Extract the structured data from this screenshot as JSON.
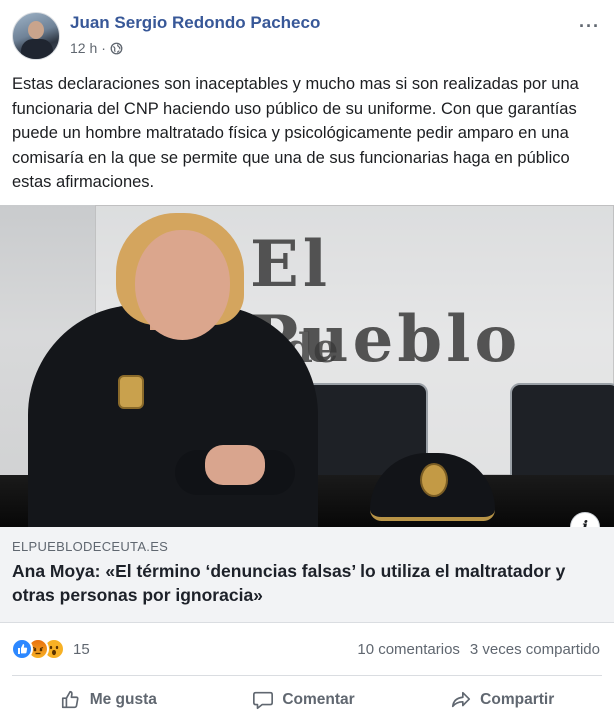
{
  "post": {
    "author": "Juan Sergio Redondo Pacheco",
    "time": "12 h",
    "separator": "·",
    "privacy_icon": "globe-icon",
    "more_label": "···",
    "text": "Estas declaraciones son inaceptables y mucho mas si son realizadas por una funcionaria del CNP haciendo uso público de su uniforme. Con que garantías puede un hombre maltratado física y psicológicamente pedir amparo en una comisaría en la que se permite que una de sus funcionarias haga en público estas afirmaciones."
  },
  "photo": {
    "sign_text_1": "El Pueblo",
    "sign_text_2": "de",
    "info_label": "i"
  },
  "link": {
    "domain": "ELPUEBLODECEUTA.ES",
    "headline": "Ana Moya: «El término ‘denuncias falsas’ lo utiliza el maltratador y otras personas por ignoracia»"
  },
  "stats": {
    "reactions": [
      "like-icon",
      "angry-icon",
      "wow-icon"
    ],
    "reaction_count": "15",
    "comments": "10 comentarios",
    "shares": "3 veces compartido"
  },
  "actions": {
    "like": "Me gusta",
    "comment": "Comentar",
    "share": "Compartir"
  },
  "colors": {
    "author_link": "#385898",
    "muted_text": "#606770",
    "link_box_bg": "#f2f3f5",
    "like_blue": "#2d88ff"
  }
}
